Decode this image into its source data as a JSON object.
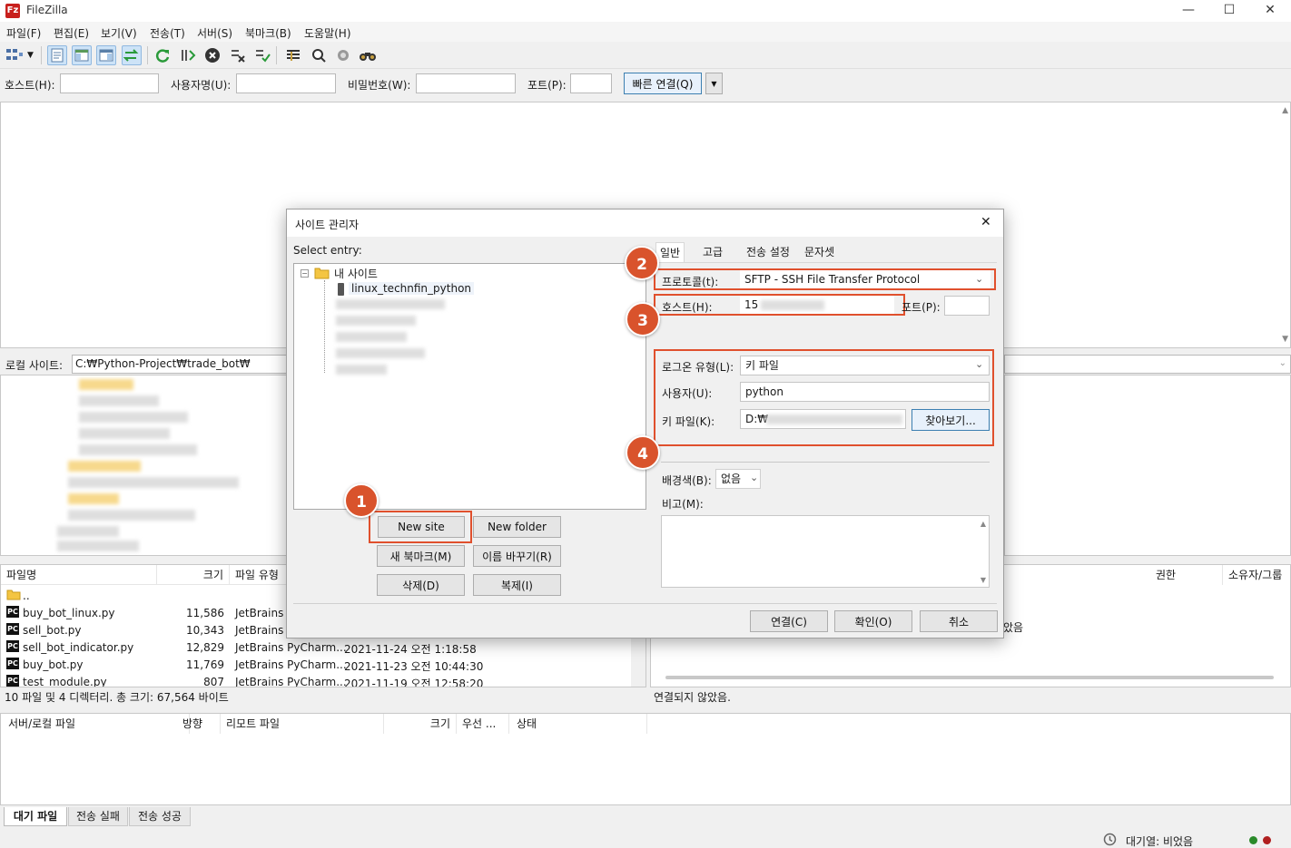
{
  "window": {
    "title": "FileZilla",
    "app_icon": "Fz",
    "minimize": "—",
    "maximize": "☐",
    "close": "✕"
  },
  "menu": [
    "파일(F)",
    "편집(E)",
    "보기(V)",
    "전송(T)",
    "서버(S)",
    "북마크(B)",
    "도움말(H)"
  ],
  "quickconnect": {
    "host_label": "호스트(H):",
    "user_label": "사용자명(U):",
    "pass_label": "비밀번호(W):",
    "port_label": "포트(P):",
    "connect_button": "빠른 연결(Q)"
  },
  "local": {
    "site_label": "로컬 사이트:",
    "path": "C:₩Python-Project₩trade_bot₩",
    "columns": [
      "파일명",
      "크기",
      "파일 유형"
    ],
    "files": [
      {
        "name": "..",
        "size": "",
        "type": "",
        "modified": ""
      },
      {
        "name": "buy_bot_linux.py",
        "size": "11,586",
        "type": "JetBrains P",
        "modified": ""
      },
      {
        "name": "sell_bot.py",
        "size": "10,343",
        "type": "JetBrains P",
        "modified": ""
      },
      {
        "name": "sell_bot_indicator.py",
        "size": "12,829",
        "type": "JetBrains PyCharm...",
        "modified": "2021-11-24 오전 1:18:58"
      },
      {
        "name": "buy_bot.py",
        "size": "11,769",
        "type": "JetBrains PyCharm...",
        "modified": "2021-11-23 오전 10:44:30"
      },
      {
        "name": "test_module.py",
        "size": "807",
        "type": "JetBrains PyCharm...",
        "modified": "2021-11-19 오전 12:58:20"
      }
    ],
    "status": "10 파일 및 4 디렉터리. 총 크기: 67,564 바이트"
  },
  "remote": {
    "columns": [
      "권한",
      "소유자/그룹"
    ],
    "empty_text": "았음",
    "status": "연결되지 않았음."
  },
  "queue": {
    "columns": [
      "서버/로컬 파일",
      "방향",
      "리모트 파일",
      "크기",
      "우선 ...",
      "상태"
    ],
    "tabs": [
      "대기 파일",
      "전송 실패",
      "전송 성공"
    ]
  },
  "statusbar": {
    "queue_text": "대기열: 비었음"
  },
  "dialog": {
    "title": "사이트 관리자",
    "close": "✕",
    "select_entry": "Select entry:",
    "tree_root": "내 사이트",
    "tree_site": "linux_technfin_python",
    "buttons": {
      "new_site": "New site",
      "new_folder": "New folder",
      "new_bookmark": "새 북마크(M)",
      "rename": "이름 바꾸기(R)",
      "delete": "삭제(D)",
      "duplicate": "복제(I)",
      "connect": "연결(C)",
      "ok": "확인(O)",
      "cancel": "취소",
      "browse": "찾아보기..."
    },
    "tabs": [
      "일반",
      "고급",
      "전송 설정",
      "문자셋"
    ],
    "protocol_label": "프로토콜(t):",
    "protocol_value": "SFTP - SSH File Transfer Protocol",
    "host_label": "호스트(H):",
    "host_value": "15",
    "port_label": "포트(P):",
    "logon_label": "로그온 유형(L):",
    "logon_value": "키 파일",
    "user_label": "사용자(U):",
    "user_value": "python",
    "keyfile_label": "키 파일(K):",
    "keyfile_value": "D:₩",
    "bgcolor_label": "배경색(B):",
    "bgcolor_value": "없음",
    "comment_label": "비고(M):",
    "badges": [
      "1",
      "2",
      "3",
      "4"
    ]
  }
}
